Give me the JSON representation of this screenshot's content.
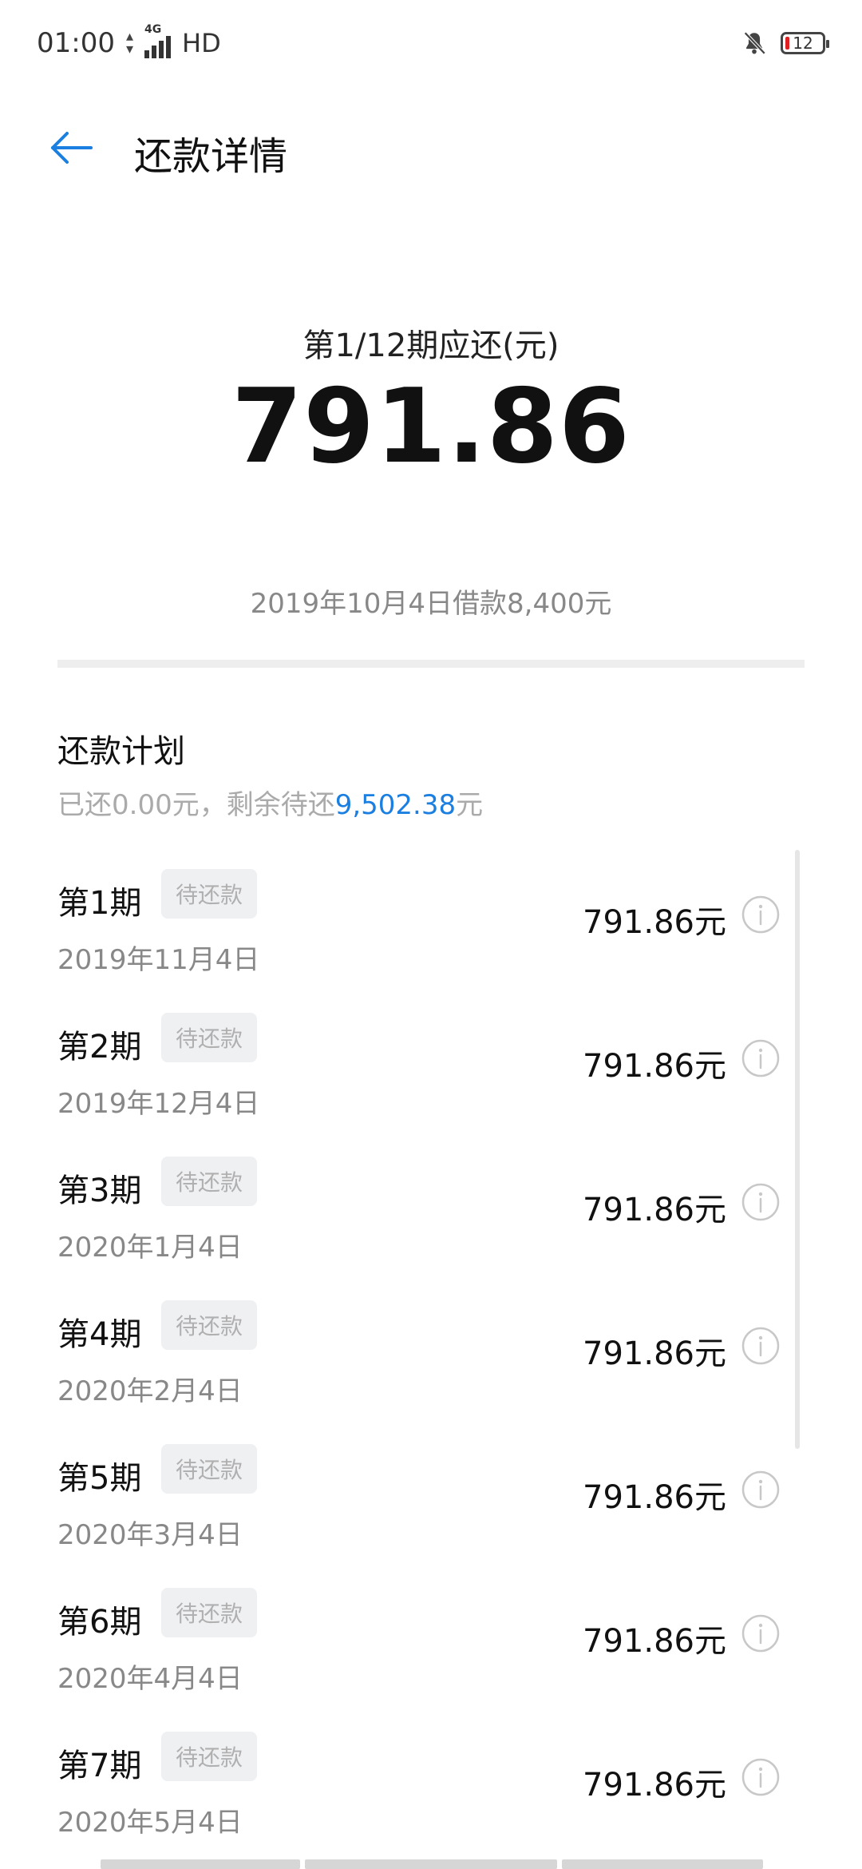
{
  "status_bar": {
    "time": "01:00",
    "network": "4G",
    "hd": "HD",
    "battery": "12"
  },
  "header": {
    "title": "还款详情"
  },
  "summary": {
    "label": "第1/12期应还(元)",
    "amount": "791.86",
    "loan_info": "2019年10月4日借款8,400元"
  },
  "plan": {
    "title": "还款计划",
    "paid_text": "已还0.00元，剩余待还",
    "remaining": "9,502.38",
    "remaining_unit": "元",
    "installments": [
      {
        "period": "第1期",
        "status": "待还款",
        "date": "2019年11月4日",
        "amount": "791.86元"
      },
      {
        "period": "第2期",
        "status": "待还款",
        "date": "2019年12月4日",
        "amount": "791.86元"
      },
      {
        "period": "第3期",
        "status": "待还款",
        "date": "2020年1月4日",
        "amount": "791.86元"
      },
      {
        "period": "第4期",
        "status": "待还款",
        "date": "2020年2月4日",
        "amount": "791.86元"
      },
      {
        "period": "第5期",
        "status": "待还款",
        "date": "2020年3月4日",
        "amount": "791.86元"
      },
      {
        "period": "第6期",
        "status": "待还款",
        "date": "2020年4月4日",
        "amount": "791.86元"
      },
      {
        "period": "第7期",
        "status": "待还款",
        "date": "2020年5月4日",
        "amount": "791.86元"
      }
    ]
  },
  "colors": {
    "accent": "#1a7fe0",
    "badge_bg": "#eff0f2",
    "muted_text": "#888888"
  }
}
